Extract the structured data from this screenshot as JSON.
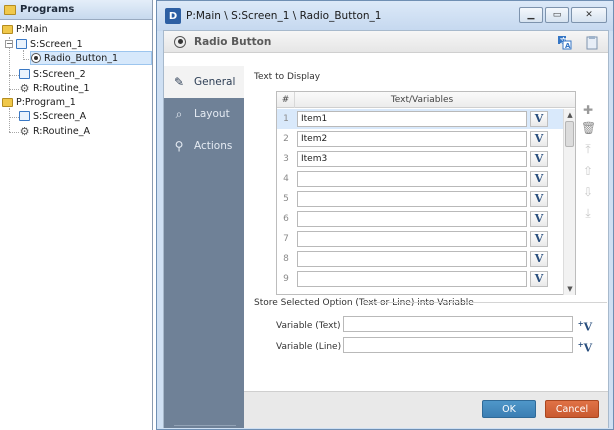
{
  "programs_panel": {
    "title": "Programs",
    "tree": [
      {
        "label": "P:Main",
        "type": "folder"
      },
      {
        "label": "S:Screen_1",
        "type": "screen"
      },
      {
        "label": "Radio_Button_1",
        "type": "radio",
        "selected": true
      },
      {
        "label": "S:Screen_2",
        "type": "screen"
      },
      {
        "label": "R:Routine_1",
        "type": "routine"
      },
      {
        "label": "P:Program_1",
        "type": "folder"
      },
      {
        "label": "S:Screen_A",
        "type": "screen"
      },
      {
        "label": "R:Routine_A",
        "type": "routine"
      }
    ]
  },
  "window": {
    "title": "P:Main \\ S:Screen_1 \\ Radio_Button_1",
    "logo": "D"
  },
  "dialog": {
    "heading": "Radio Button",
    "header_icons": [
      "translate-icon",
      "clipboard-icon"
    ],
    "nav": [
      {
        "label": "General",
        "icon": "pencil-icon",
        "active": true
      },
      {
        "label": "Layout",
        "icon": "magnifier-icon",
        "active": false
      },
      {
        "label": "Actions",
        "icon": "link-icon",
        "active": false
      }
    ],
    "text_to_display": {
      "title": "Text to Display",
      "col_hash": "#",
      "col_text": "Text/Variables",
      "v_label": "V",
      "rows": [
        {
          "n": "1",
          "value": "Item1"
        },
        {
          "n": "2",
          "value": "Item2"
        },
        {
          "n": "3",
          "value": "Item3"
        },
        {
          "n": "4",
          "value": ""
        },
        {
          "n": "5",
          "value": ""
        },
        {
          "n": "6",
          "value": ""
        },
        {
          "n": "7",
          "value": ""
        },
        {
          "n": "8",
          "value": ""
        },
        {
          "n": "9",
          "value": ""
        }
      ],
      "selected_row": 1,
      "tools": [
        "add-icon",
        "delete-icon",
        "move-top-icon",
        "move-up-icon",
        "move-down-icon",
        "move-bottom-icon"
      ]
    },
    "store": {
      "title": "Store Selected Option (Text or Line) into Variable",
      "variable_text_label": "Variable (Text)",
      "variable_text_value": "",
      "variable_line_label": "Variable (Line)",
      "variable_line_value": "",
      "v_label": "V",
      "v_plus": "+"
    },
    "ok_label": "OK",
    "cancel_label": "Cancel"
  },
  "colors": {
    "ok": "#3f83b8",
    "cancel": "#cf6035",
    "nav": "#6f8197"
  }
}
